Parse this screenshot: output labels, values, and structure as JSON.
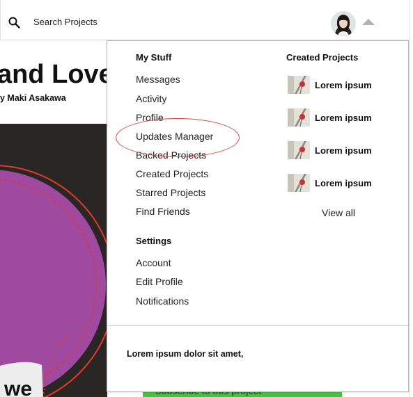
{
  "header": {
    "search_placeholder": "Search Projects",
    "search_icon": "magnifier",
    "avatar_icon": "user-avatar",
    "menu_toggle_icon": "caret-up"
  },
  "background": {
    "title_fragment": "and Love",
    "byline_fragment": "y Maki Asakawa",
    "badge_fragment": "we",
    "subscribe_label": "Subscribe to this project",
    "hero_colors": {
      "purple": "#a04a9f",
      "dark": "#262626",
      "red": "#e23a27"
    },
    "subscribe_color": "#46c047"
  },
  "dropdown": {
    "my_stuff": {
      "title": "My Stuff",
      "items": [
        "Messages",
        "Activity",
        "Profile",
        "Updates Manager",
        "Backed Projects",
        "Created Projects",
        "Starred Projects",
        "Find Friends"
      ]
    },
    "settings": {
      "title": "Settings",
      "items": [
        "Account",
        "Edit Profile",
        "Notifications"
      ]
    },
    "created_projects": {
      "title": "Created Projects",
      "items": [
        "Lorem ipsum",
        "Lorem ipsum",
        "Lorem ipsum",
        "Lorem ipsum"
      ],
      "view_all": "View all"
    },
    "footer": "Lorem ipsum dolor sit amet,",
    "highlight_color": "#d9413b"
  }
}
